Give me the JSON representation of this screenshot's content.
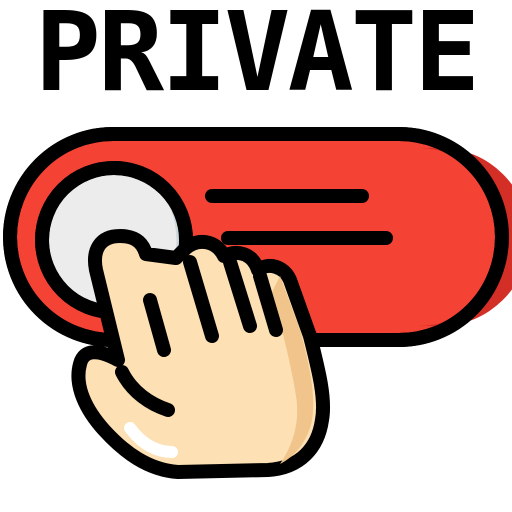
{
  "title": "PRIVATE",
  "colors": {
    "outline": "#000000",
    "toggle_track": "#f44335",
    "toggle_track_shade": "#d32f27",
    "knob": "#ececec",
    "knob_shade": "#cfd8dc",
    "skin": "#fde0b4",
    "skin_shade": "#f0c48a"
  },
  "icons": {
    "toggle": "toggle-switch-icon",
    "hand": "pointing-hand-icon"
  }
}
